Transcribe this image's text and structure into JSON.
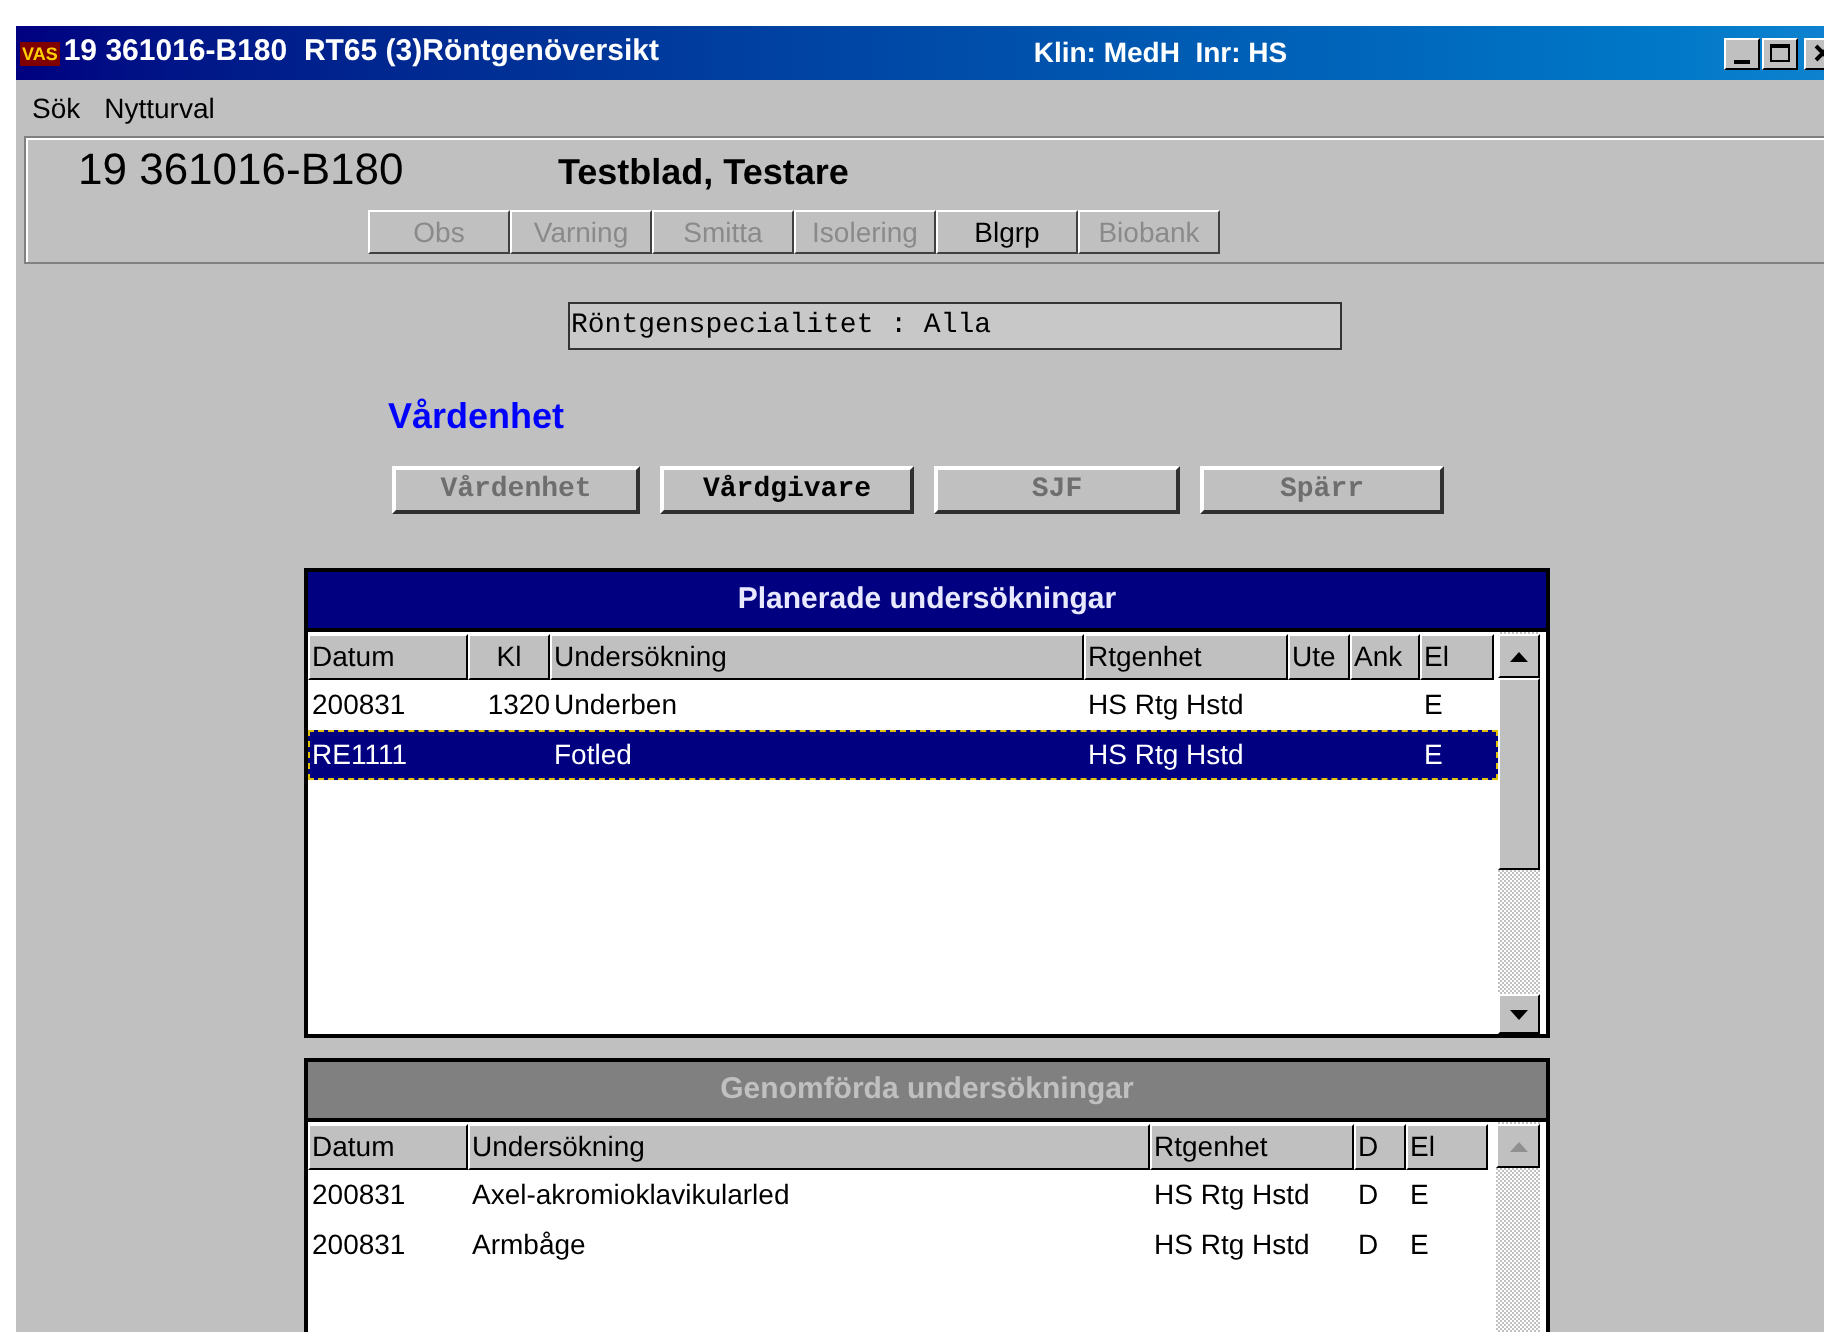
{
  "window": {
    "app_badge": "VAS",
    "title": "19 361016-B180  RT65 (3)Röntgenöversikt",
    "context": "Klin: MedH  Inr: HS"
  },
  "menu": [
    "Sök",
    "Nytturval"
  ],
  "patient": {
    "id": "19 361016-B180",
    "name": "Testblad, Testare",
    "flags": [
      {
        "label": "Obs",
        "disabled": true
      },
      {
        "label": "Varning",
        "disabled": true
      },
      {
        "label": "Smitta",
        "disabled": true
      },
      {
        "label": "Isolering",
        "disabled": true
      },
      {
        "label": "Blgrp",
        "disabled": false
      },
      {
        "label": "Biobank",
        "disabled": true
      }
    ]
  },
  "specialty_field": {
    "value": "Röntgenspecialitet : Alla"
  },
  "unit_heading": "Vårdenhet",
  "unit_buttons": [
    {
      "label": "Vårdenhet",
      "disabled": true
    },
    {
      "label": "Vårdgivare",
      "disabled": false
    },
    {
      "label": "SJF",
      "disabled": true
    },
    {
      "label": "Spärr",
      "disabled": true
    }
  ],
  "panels": [
    {
      "title": "Planerade undersökningar",
      "active": true,
      "columns": [
        "Datum",
        "Kl",
        "Undersökning",
        "Rtgenhet",
        "Ute",
        "Ank",
        "El"
      ],
      "rows": [
        {
          "cells": [
            "200831",
            "1320",
            "Underben",
            "HS Rtg Hstd",
            "",
            "",
            "E"
          ],
          "selected": false
        },
        {
          "cells": [
            "RE1111",
            "",
            "Fotled",
            "HS Rtg Hstd",
            "",
            "",
            "E"
          ],
          "selected": true
        }
      ]
    },
    {
      "title": "Genomförda undersökningar",
      "active": false,
      "columns": [
        "Datum",
        "Undersökning",
        "Rtgenhet",
        "D",
        "El"
      ],
      "rows": [
        {
          "cells": [
            "200831",
            "Axel-akromioklavikularled",
            "HS Rtg Hstd",
            "D",
            "E"
          ],
          "selected": false
        },
        {
          "cells": [
            "200831",
            "Armbåge",
            "HS Rtg Hstd",
            "D",
            "E"
          ],
          "selected": false
        }
      ]
    }
  ]
}
